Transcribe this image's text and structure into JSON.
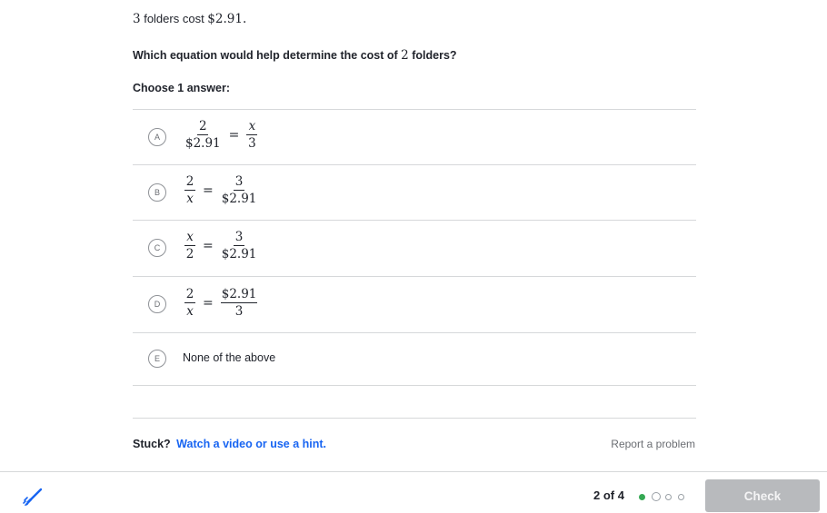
{
  "prompt": {
    "count": "3",
    "text": " folders cost ",
    "price": "$2.91",
    "period": "."
  },
  "question": {
    "before": "Which equation would help determine the cost of ",
    "number": "2",
    "after": " folders?"
  },
  "choose_label": "Choose 1 answer:",
  "choices": [
    {
      "letter": "A",
      "left": {
        "num": "2",
        "den": "$2.91"
      },
      "eq": "=",
      "right": {
        "num": "x",
        "den": "3"
      }
    },
    {
      "letter": "B",
      "left": {
        "num": "2",
        "den": "x"
      },
      "eq": "=",
      "right": {
        "num": "3",
        "den": "$2.91"
      }
    },
    {
      "letter": "C",
      "left": {
        "num": "x",
        "den": "2"
      },
      "eq": "=",
      "right": {
        "num": "3",
        "den": "$2.91"
      }
    },
    {
      "letter": "D",
      "left": {
        "num": "2",
        "den": "x"
      },
      "eq": "=",
      "right": {
        "num": "$2.91",
        "den": "3"
      }
    },
    {
      "letter": "E",
      "text": "None of the above"
    }
  ],
  "stuck": {
    "label": "Stuck?",
    "link": "Watch a video or use a hint."
  },
  "report_link": "Report a problem",
  "footer": {
    "progress": "2 of 4",
    "dots": [
      "done",
      "current",
      "todo",
      "todo"
    ],
    "check_label": "Check",
    "scratchpad_icon": "scratchpad-pencil-icon"
  },
  "colors": {
    "link": "#1865f2",
    "progress_done": "#35a853",
    "check_disabled": "#b8babd"
  }
}
